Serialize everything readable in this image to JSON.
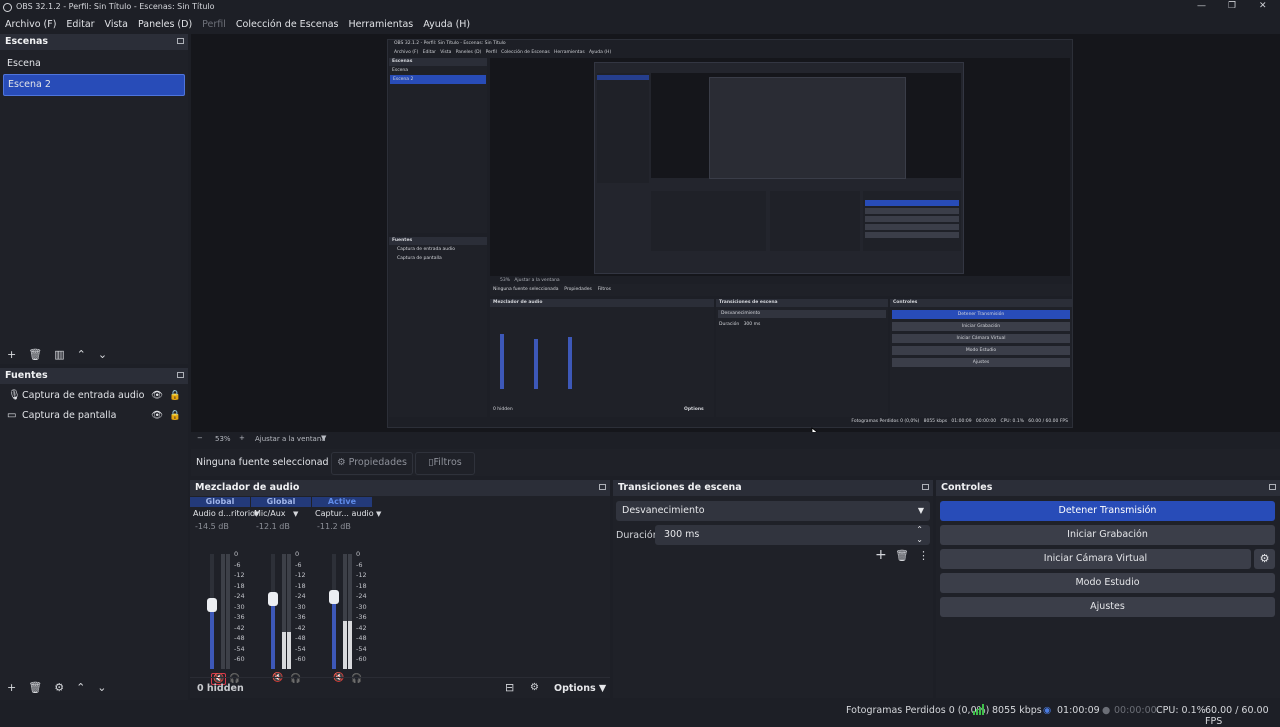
{
  "window": {
    "title": "OBS 32.1.2 - Perfil: Sin Título - Escenas: Sin Título"
  },
  "menu": [
    {
      "label": "Archivo (F)",
      "enabled": true
    },
    {
      "label": "Editar",
      "enabled": true
    },
    {
      "label": "Vista",
      "enabled": true
    },
    {
      "label": "Paneles (D)",
      "enabled": true
    },
    {
      "label": "Perfil",
      "enabled": false
    },
    {
      "label": "Colección de Escenas",
      "enabled": true
    },
    {
      "label": "Herramientas",
      "enabled": true
    },
    {
      "label": "Ayuda (H)",
      "enabled": true
    }
  ],
  "scenes": {
    "title": "Escenas",
    "items": [
      {
        "label": "Escena",
        "selected": false
      },
      {
        "label": "Escena 2",
        "selected": true
      }
    ]
  },
  "sources": {
    "title": "Fuentes",
    "items": [
      {
        "label": "Captura de entrada audio",
        "icon": "microphone-icon"
      },
      {
        "label": "Captura de pantalla",
        "icon": "monitor-icon"
      }
    ]
  },
  "preview": {
    "zoom": "53%",
    "fit_label": "Ajustar a la ventana",
    "nested": {
      "title": "OBS 32.1.2 - Perfil: Sin Título - Escenas: Sin Título",
      "menu": "Archivo (F)   Editar   Vista   Paneles (D)   Perfil   Colección de Escenas   Herramientas   Ayuda (H)",
      "scenes_title": "Escenas",
      "scene_items": [
        "Escena",
        "Escena 2"
      ],
      "sources_title": "Fuentes",
      "source_items": [
        "Captura de entrada audio",
        "Captura de pantalla"
      ],
      "mixer_title": "Mezclador de audio",
      "transitions_title": "Transiciones de escena",
      "controls_title": "Controles",
      "transition": "Desvanecimiento",
      "duration_label": "Duración",
      "duration": "300 ms",
      "buttons": [
        "Detener Transmisión",
        "Iniciar Grabación",
        "Iniciar Cámara Virtual",
        "Modo Estudio",
        "Ajustes"
      ],
      "no_source": "Ninguna fuente seleccionada",
      "properties": "Propiedades",
      "filters": "Filtros",
      "hidden": "0 hidden",
      "options": "Options",
      "status": "Fotogramas Perdidos 0 (0,0%)   8055 kbps   01:00:09   00:00:00   CPU: 0.1%   60.00 / 60.00 FPS",
      "zoom": "53%",
      "fit_label": "Ajustar a la ventana"
    }
  },
  "context_bar": {
    "no_source": "Ninguna fuente seleccionad",
    "properties": "Propiedades",
    "filters": "Filtros"
  },
  "mixer": {
    "title": "Mezclador de audio",
    "channels": [
      {
        "tag": "Global",
        "tag_color": "#9fb4e8",
        "name": "Audio d...ritorio",
        "db": "-14.5 dB",
        "volume": 0.55,
        "level": 0.0,
        "muted": true
      },
      {
        "tag": "Global",
        "tag_color": "#9fb4e8",
        "name": "Mic/Aux",
        "db": "-12.1 dB",
        "volume": 0.6,
        "level": 0.32,
        "muted": true
      },
      {
        "tag": "Active",
        "tag_color": "#5f8be8",
        "name": "Captur... audio",
        "db": "-11.2 dB",
        "volume": 0.62,
        "level": 0.42,
        "muted": true
      }
    ],
    "ticks": [
      "0",
      "-6",
      "-12",
      "-18",
      "-24",
      "-30",
      "-36",
      "-42",
      "-48",
      "-54",
      "-60"
    ],
    "hidden_label": "0 hidden",
    "options_label": "Options"
  },
  "transitions": {
    "title": "Transiciones de escena",
    "selected": "Desvanecimiento",
    "duration_label": "Duración",
    "duration": "300 ms"
  },
  "controls": {
    "title": "Controles",
    "stop_stream": "Detener Transmisión",
    "start_recording": "Iniciar Grabación",
    "start_virtual_cam": "Iniciar Cámara Virtual",
    "studio_mode": "Modo Estudio",
    "settings": "Ajustes",
    "accent": "#284cb8"
  },
  "status": {
    "dropped": "Fotogramas Perdidos 0 (0,0%)",
    "bitrate": "8055 kbps",
    "stream_time": "01:00:09",
    "rec_time": "00:00:00",
    "cpu": "CPU: 0.1%",
    "fps": "60.00 / 60.00 FPS"
  }
}
